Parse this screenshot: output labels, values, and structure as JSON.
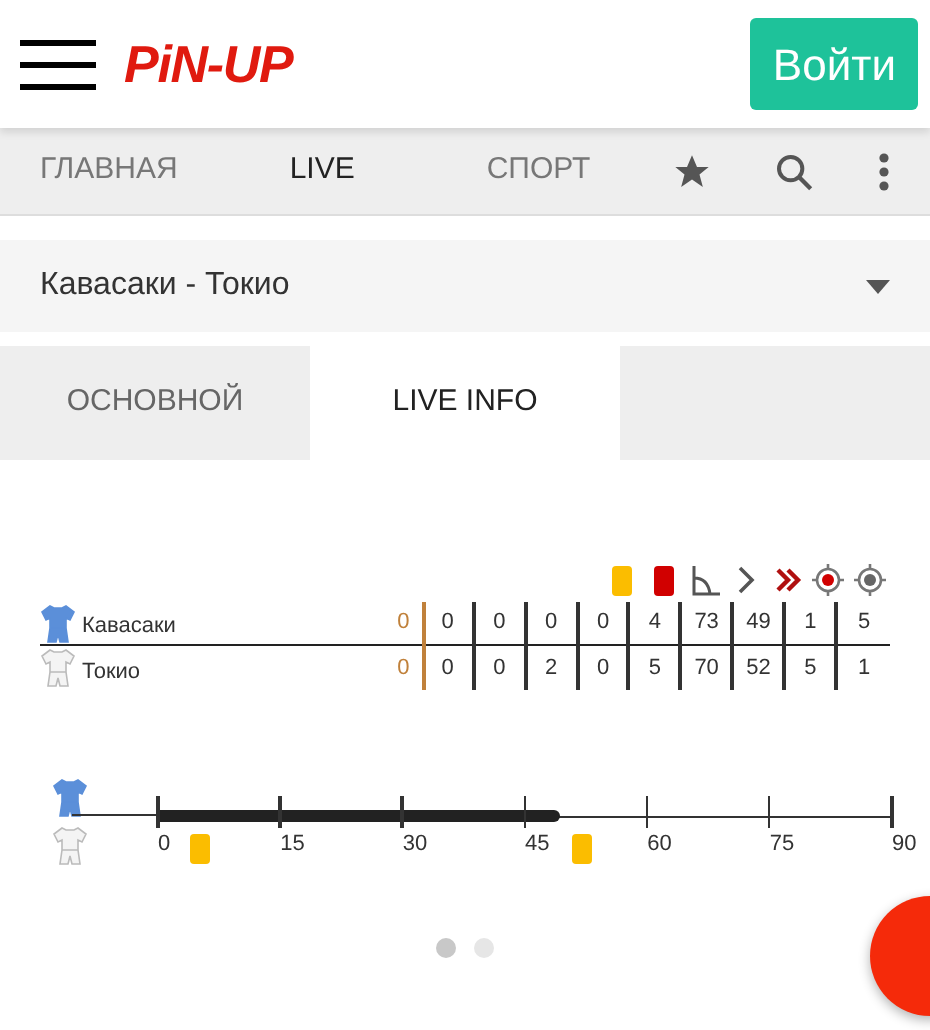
{
  "header": {
    "logo": "PiN-UP",
    "login_button": "Войти"
  },
  "nav": {
    "items": [
      {
        "label": "ГЛАВНАЯ",
        "selected": false
      },
      {
        "label": "LIVE",
        "selected": true
      },
      {
        "label": "СПОРТ",
        "selected": false
      }
    ]
  },
  "match_select": {
    "value": "Кавасаки - Токио"
  },
  "tabs": [
    {
      "label": "ОСНОВНОЙ",
      "selected": false
    },
    {
      "label": "LIVE INFO",
      "selected": true
    }
  ],
  "stats": {
    "columns": [
      {
        "kind": "blank"
      },
      {
        "kind": "blank"
      },
      {
        "kind": "yellow-card"
      },
      {
        "kind": "red-card"
      },
      {
        "kind": "corner"
      },
      {
        "kind": "attack"
      },
      {
        "kind": "dangerous-attack"
      },
      {
        "kind": "shot-on-target"
      },
      {
        "kind": "shot-off-target"
      }
    ],
    "teams": [
      {
        "name": "Кавасаки",
        "color": "#5b8fd9",
        "score": "0",
        "values": [
          "0",
          "0",
          "0",
          "0",
          "4",
          "73",
          "49",
          "1",
          "5"
        ]
      },
      {
        "name": "Токио",
        "color": "#f4f4f4",
        "score": "0",
        "values": [
          "0",
          "0",
          "2",
          "0",
          "5",
          "70",
          "52",
          "5",
          "1"
        ]
      }
    ]
  },
  "timeline": {
    "level": 0.55,
    "ticks": [
      "0",
      "15",
      "30",
      "45",
      "60",
      "75",
      "90"
    ],
    "events": [
      {
        "kind": "yellow-card"
      },
      {
        "kind": "yellow-card"
      }
    ]
  },
  "pager": [
    {
      "selected": true
    },
    {
      "selected": false
    }
  ]
}
